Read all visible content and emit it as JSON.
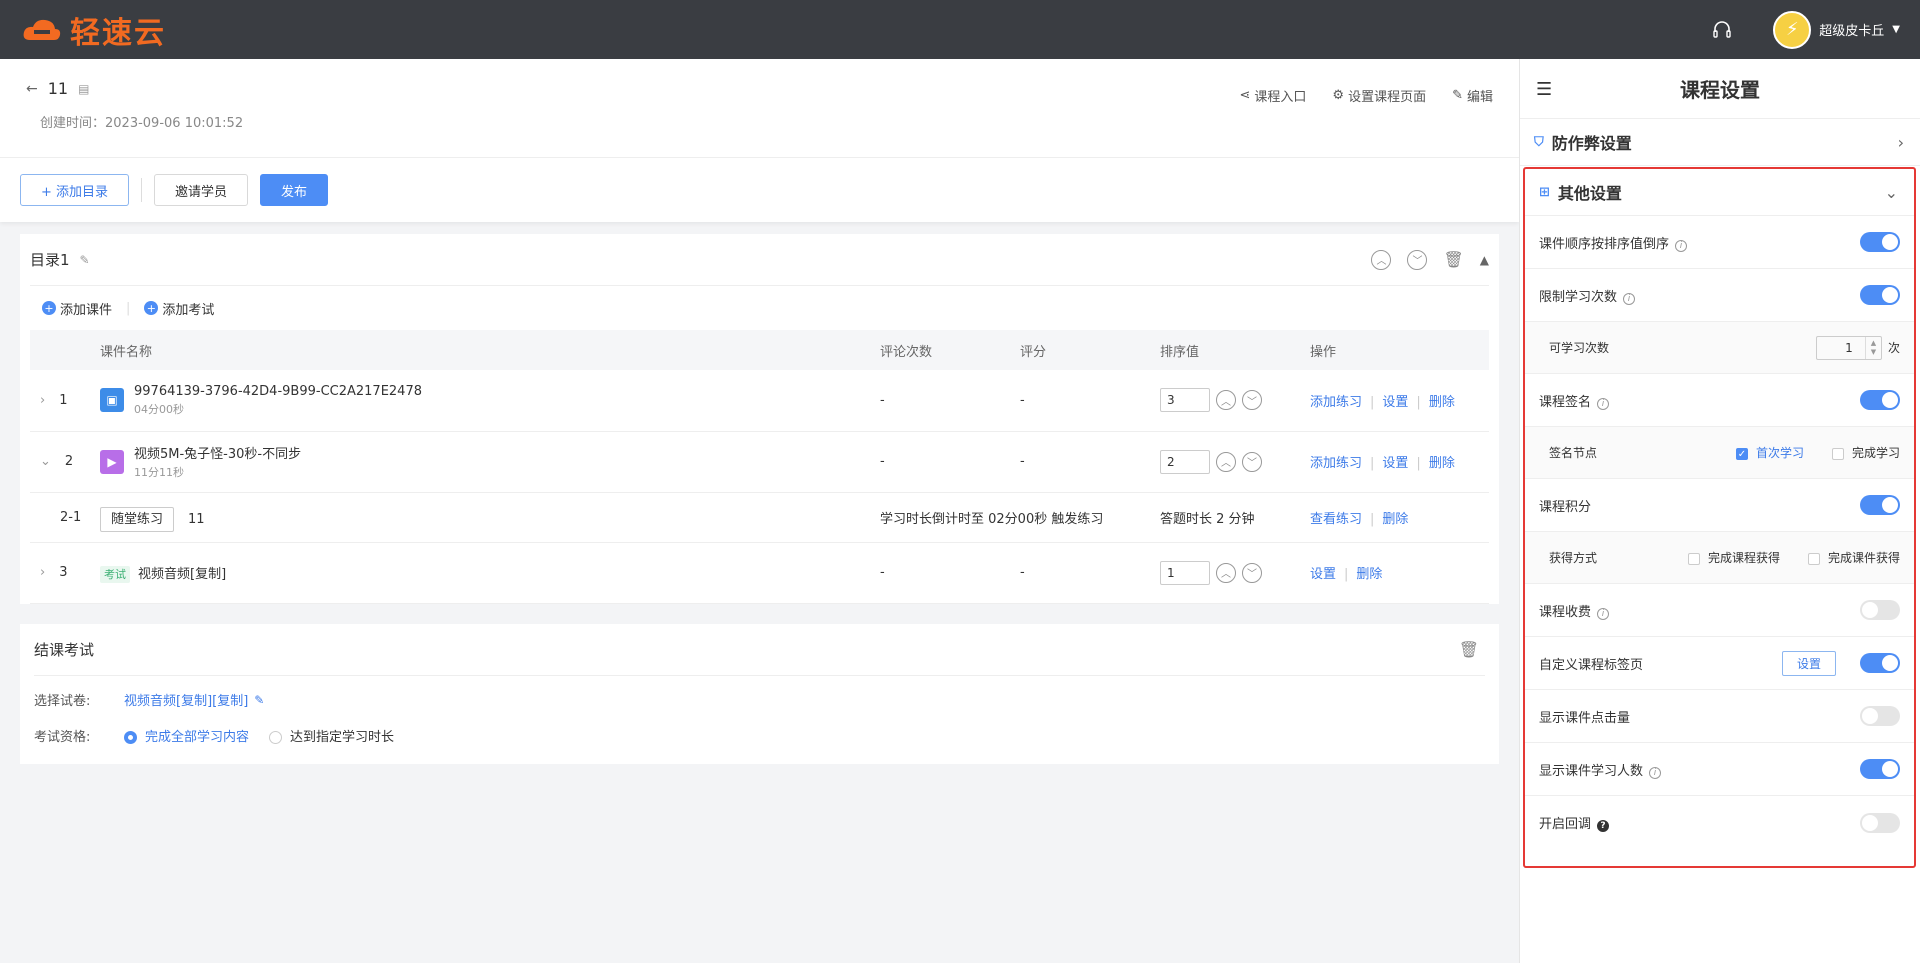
{
  "app": {
    "logo_text": "轻速云",
    "user_name": "超级皮卡丘"
  },
  "course": {
    "title": "11",
    "created_label": "创建时间：",
    "created_value": "2023-09-06 10:01:52"
  },
  "header_actions": {
    "entry": "课程入口",
    "page_setting": "设置课程页面",
    "edit": "编辑"
  },
  "toolbar": {
    "add_dir": "+ 添加目录",
    "invite": "邀请学员",
    "publish": "发布"
  },
  "directory": {
    "title": "目录1",
    "add_course": "添加课件",
    "add_exam": "添加考试",
    "columns": [
      "课件名称",
      "评论次数",
      "评分",
      "排序值",
      "操作"
    ],
    "rows": [
      {
        "idx": "1",
        "name": "99764139-3796-42D4-9B99-CC2A217E2478",
        "dur": "04分00秒",
        "comments": "-",
        "score": "-",
        "sort": "3",
        "a1": "添加练习",
        "a2": "设置",
        "a3": "删除"
      },
      {
        "idx": "2",
        "name": "视频5M-兔子怪-30秒-不同步",
        "dur": "11分11秒",
        "comments": "-",
        "score": "-",
        "sort": "2",
        "a1": "添加练习",
        "a2": "设置",
        "a3": "删除"
      }
    ],
    "sub_row": {
      "idx": "2-1",
      "tag": "随堂练习",
      "name": "11",
      "trigger": "学习时长倒计时至 02分00秒 触发练习",
      "duration": "答题时长 2 分钟",
      "a1": "查看练习",
      "a2": "删除"
    },
    "exam_row": {
      "idx": "3",
      "tag": "考试",
      "name": "视频音频[复制]",
      "comments": "-",
      "score": "-",
      "sort": "1",
      "a1": "设置",
      "a2": "删除"
    }
  },
  "final_exam": {
    "title": "结课考试",
    "paper_label": "选择试卷:",
    "paper_value": "视频音频[复制][复制]",
    "qual_label": "考试资格:",
    "opt1": "完成全部学习内容",
    "opt2": "达到指定学习时长"
  },
  "side": {
    "title": "课程设置",
    "anti_cheat": "防作弊设置",
    "other": "其他设置",
    "s1": "课件顺序按排序值倒序",
    "s2": "限制学习次数",
    "s2_sub": "可学习次数",
    "s2_value": "1",
    "s2_unit": "次",
    "s3": "课程签名",
    "s3_sub": "签名节点",
    "s3_opt1": "首次学习",
    "s3_opt2": "完成学习",
    "s4": "课程积分",
    "s4_sub": "获得方式",
    "s4_opt1": "完成课程获得",
    "s4_opt2": "完成课件获得",
    "s5": "课程收费",
    "s6": "自定义课程标签页",
    "s6_btn": "设置",
    "s7": "显示课件点击量",
    "s8": "显示课件学习人数",
    "s9": "开启回调"
  }
}
